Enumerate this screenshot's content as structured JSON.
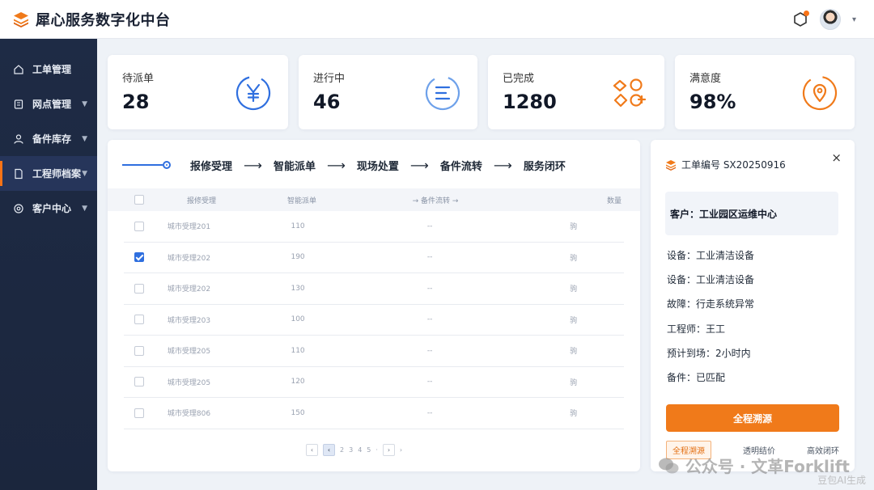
{
  "app": {
    "title": "犀心服务数字化中台"
  },
  "sidebar": {
    "items": [
      {
        "label": "工单管理",
        "icon": "home-icon",
        "expandable": false
      },
      {
        "label": "网点管理",
        "icon": "building-icon",
        "expandable": true
      },
      {
        "label": "备件库存",
        "icon": "user-icon",
        "expandable": true
      },
      {
        "label": "工程师档案",
        "icon": "file-icon",
        "expandable": true,
        "active": true
      },
      {
        "label": "客户中心",
        "icon": "settings-icon",
        "expandable": true
      }
    ]
  },
  "stats": [
    {
      "label": "待派单",
      "value": "28",
      "icon": "yen-icon",
      "color": "#2f6fdf"
    },
    {
      "label": "进行中",
      "value": "46",
      "icon": "progress-list-icon",
      "color": "#2f6fdf"
    },
    {
      "label": "已完成",
      "value": "1280",
      "icon": "shapes-icon",
      "color": "#f07a1a"
    },
    {
      "label": "满意度",
      "value": "98%",
      "icon": "location-pin-icon",
      "color": "#f07a1a"
    }
  ],
  "flow": {
    "steps": [
      "报修受理",
      "智能派单",
      "现场处置",
      "备件流转",
      "服务闭环"
    ],
    "arrow": "⟶"
  },
  "table": {
    "headers": [
      "报修受理",
      "智能派单",
      "→ 备件流转 →",
      "数量"
    ],
    "rows": [
      {
        "name": "城市受理201",
        "num": "110",
        "flow": "--",
        "unit": "驹",
        "checked": false
      },
      {
        "name": "城市受理202",
        "num": "190",
        "flow": "--",
        "unit": "驹",
        "checked": true
      },
      {
        "name": "城市受理202",
        "num": "130",
        "flow": "--",
        "unit": "驹",
        "checked": false
      },
      {
        "name": "城市受理203",
        "num": "100",
        "flow": "--",
        "unit": "驹",
        "checked": false
      },
      {
        "name": "城市受理205",
        "num": "110",
        "flow": "--",
        "unit": "驹",
        "checked": false
      },
      {
        "name": "城市受理205",
        "num": "120",
        "flow": "--",
        "unit": "驹",
        "checked": false
      },
      {
        "name": "城市受理806",
        "num": "150",
        "flow": "--",
        "unit": "驹",
        "checked": false
      }
    ]
  },
  "pagination": {
    "prev": "‹",
    "current": "‹",
    "pages": [
      "2",
      "3",
      "4",
      "5",
      "·"
    ],
    "next": "›",
    "last": "›"
  },
  "detail": {
    "order_label": "工单编号 SX20250916",
    "close": "×",
    "customer": "客户：工业园区运维中心",
    "lines": [
      "设备：工业清洁设备",
      "设备：工业清洁设备",
      "故障：行走系统异常",
      "工程师：王工",
      "预计到场：2小时内",
      "备件：已匹配"
    ],
    "primary_button": "全程溯源",
    "sub_actions": [
      "全程溯源",
      "透明结价",
      "高效闭环"
    ]
  },
  "watermark": {
    "text": "公众号 · 文革Forklift",
    "sub": "豆包AI生成"
  }
}
